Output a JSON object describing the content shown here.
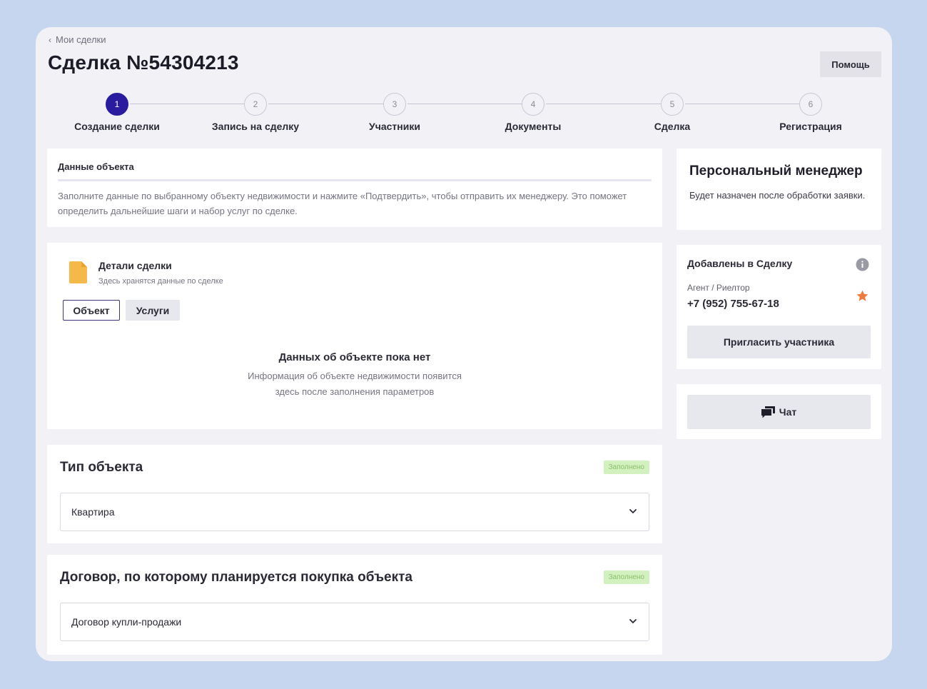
{
  "breadcrumb": {
    "label": "Мои сделки"
  },
  "page": {
    "title": "Сделка №54304213"
  },
  "header": {
    "help_label": "Помощь"
  },
  "stepper": {
    "active_index": 0,
    "steps": [
      {
        "number": "1",
        "label": "Создание сделки"
      },
      {
        "number": "2",
        "label": "Запись на сделку"
      },
      {
        "number": "3",
        "label": "Участники"
      },
      {
        "number": "4",
        "label": "Документы"
      },
      {
        "number": "5",
        "label": "Сделка"
      },
      {
        "number": "6",
        "label": "Регистрация"
      }
    ]
  },
  "object_data": {
    "title": "Данные объекта",
    "description": "Заполните данные по выбранному объекту недвижимости и нажмите «Подтвердить», чтобы отправить их менеджеру. Это поможет определить дальнейшие шаги и набор услуг по сделке."
  },
  "deal_details": {
    "icon": "file-icon",
    "title": "Детали сделки",
    "subtitle": "Здесь хранятся данные по сделке",
    "tabs": {
      "object": "Объект",
      "services": "Услуги"
    },
    "empty_title": "Данных об объекте пока нет",
    "empty_line_1": "Информация об объекте недвижимости появится",
    "empty_line_2": "здесь после заполнения параметров"
  },
  "object_type": {
    "title": "Тип объекта",
    "badge": "Заполнено",
    "value": "Квартира"
  },
  "contract": {
    "title": "Договор, по которому планируется покупка объекта",
    "badge": "Заполнено",
    "value": "Договор купли-продажи"
  },
  "manager": {
    "title": "Персональный менеджер",
    "text": "Будет назначен после обработки заявки."
  },
  "added": {
    "title": "Добавлены в Сделку",
    "role": "Агент / Риелтор",
    "phone": "+7 (952) 755-67-18",
    "invite_label": "Пригласить участника"
  },
  "chat": {
    "label": "Чат"
  },
  "colors": {
    "accent": "#2a1c9e",
    "background": "#c6d6ee",
    "badge_bg": "#d3f0bf",
    "star": "#f07a3c",
    "file_icon": "#f5b94a"
  }
}
